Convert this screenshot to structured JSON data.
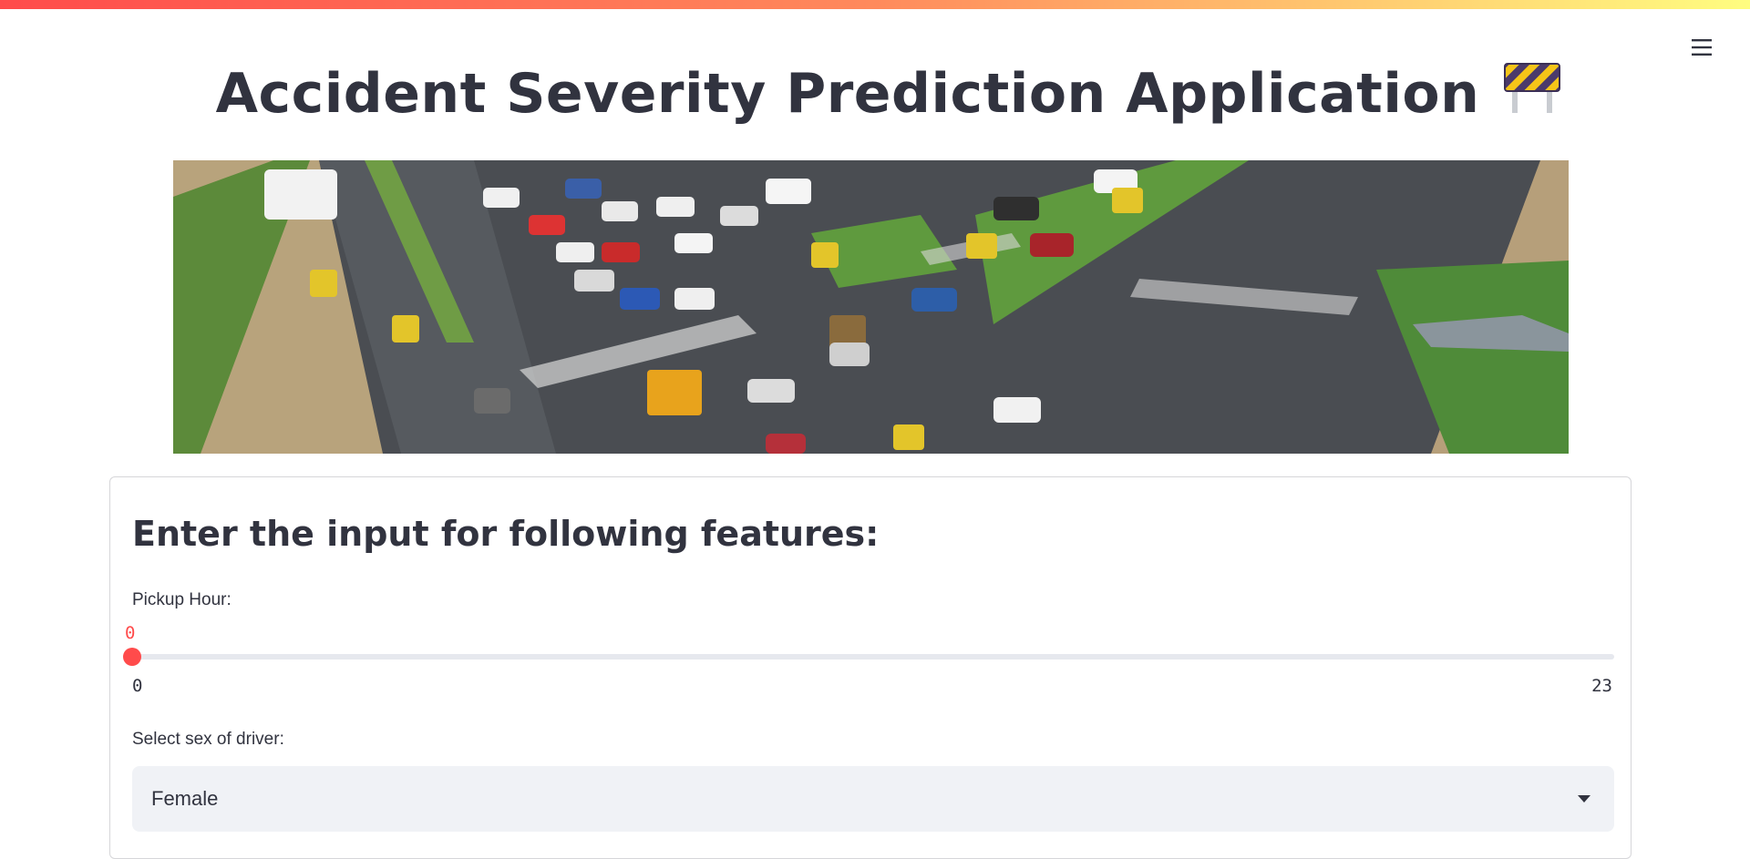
{
  "app": {
    "title": "Accident Severity Prediction Application",
    "title_icon": "construction-barrier-icon",
    "accent_color": "#ff4b4b"
  },
  "header": {
    "menu_icon": "hamburger-menu-icon"
  },
  "banner": {
    "icon": "traffic-intersection-photo"
  },
  "form": {
    "heading": "Enter the input for following features:",
    "pickup_hour": {
      "label": "Pickup Hour:",
      "value": "0",
      "min": "0",
      "max": "23"
    },
    "driver_sex": {
      "label": "Select sex of driver:",
      "selected": "Female"
    }
  }
}
